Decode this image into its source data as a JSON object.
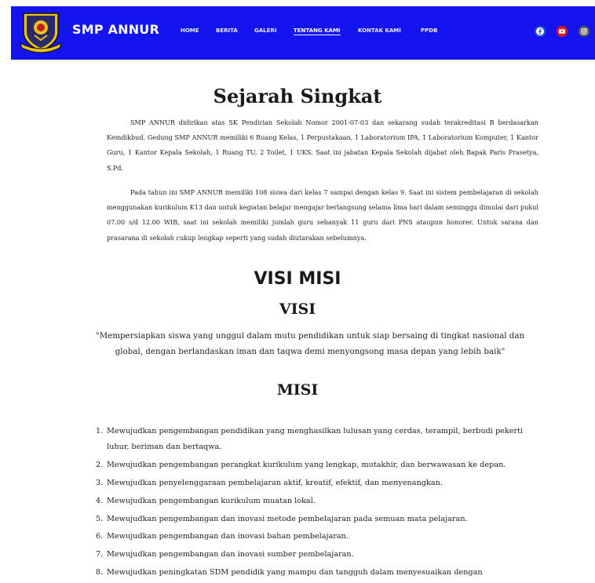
{
  "header": {
    "brand": "SMP ANNUR",
    "logo_icon": "school-crest-logo",
    "menu": [
      {
        "label": "HOME"
      },
      {
        "label": "BERITA"
      },
      {
        "label": "GALERI"
      },
      {
        "label": "TENTANG KAMI",
        "active": true
      },
      {
        "label": "KONTAK KAMI"
      },
      {
        "label": "PPDB"
      }
    ],
    "social": [
      "facebook-icon",
      "youtube-icon",
      "instagram-icon"
    ],
    "colors": {
      "bar": "#1414f0",
      "facebook": "#2b4fd6",
      "youtube": "#e01818",
      "instagram": "#5a5a5a"
    }
  },
  "sejarah": {
    "title": "Sejarah Singkat",
    "p1": "SMP ANNUR didirikan atas SK Pendirian Sekolah Nomor 2001-07-03 dan sekarang sudah terakreditasi B berdasarkan Kemdikbud. Gedung SMP ANNUR memiliki 6 Ruang Kelas, 1 Perpustakaan, 1 Laboratorium IPA, 1 Laboratorium Komputer, 1 Kantor Guru, 1 Kantor Kepala Sekolah, 1 Ruang TU, 2 Toilet, 1 UKS. Saat ini jabatan Kepala Sekolah dijabat oleh Bapak Paris Prasetya, S.Pd.",
    "p2": "Pada tahun ini SMP ANNUR memiliki 108 siswa dari kelas 7 sampai dengan kelas 9. Saat ini sistem pembelajaran di sekolah menggunakan kurikulum K13 dan untuk kegiatan belajar mengajar berlangsung selama lima hari dalam seminggu dimulai dari pukul 07.00 s/d 12.00 WIB, saat ini sekolah memiliki jumlah guru sebanyak 11 guru dari PNS ataupun honorer. Untuk sarana dan prasarana di sekolah cukup lengkap seperti yang sudah diutarakan sebelumnya."
  },
  "visimisi": {
    "title": "VISI MISI",
    "visi_title": "VISI",
    "visi_text": "\"Mempersiapkan siswa yang unggul dalam mutu pendidikan untuk siap bersaing di tingkat nasional dan global, dengan berlandaskan iman dan taqwa demi menyongsong masa depan yang lebih baik\"",
    "misi_title": "MISI",
    "misi": [
      {
        "n": "1.",
        "text": "Mewujudkan pengembangan pendidikan yang menghasilkan lulusan yang cerdas, terampil, berbudi pekerti luhur, beriman dan bertaqwa."
      },
      {
        "n": "2.",
        "text": "Mewujudkan pengembangan perangkat kurikulum yang lengkap, mutakhir, dan berwawasan ke depan."
      },
      {
        "n": "3.",
        "text": "Mewujudkan penyelenggaraan pembelajaran aktif, kreatif, efektif, dan menyenangkan."
      },
      {
        "n": "4.",
        "text": "Mewujudkan  pengembangan kurikulum muatan lokal."
      },
      {
        "n": "5.",
        "text": "Mewujudkan  pengembangan dan inovasi metode pembelajaran pada semuan mata  pelajaran."
      },
      {
        "n": "6.",
        "text": "Mewujudkan pengembangan dan inovasi bahan pembelajaran."
      },
      {
        "n": "7.",
        "text": "Mewujudkan pengembangan dan inovasi sumber pembelajaran."
      },
      {
        "n": "8.",
        "text": "Mewujudkan  peningkatan SDM pendidik yang mampu dan tangguh dalam menyesuaikan dengan"
      }
    ]
  }
}
